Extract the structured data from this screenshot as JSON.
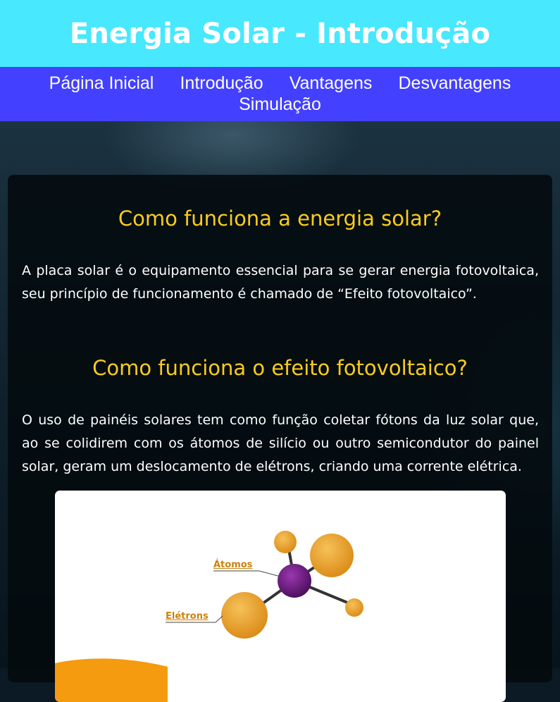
{
  "header": {
    "title": "Energia Solar - Introdução"
  },
  "nav": {
    "items": [
      {
        "label": "Página Inicial"
      },
      {
        "label": "Introdução"
      },
      {
        "label": "Vantagens"
      },
      {
        "label": "Desvantagens"
      },
      {
        "label": "Simulação"
      }
    ]
  },
  "main": {
    "section1": {
      "heading": "Como funciona a energia solar?",
      "text": "A placa solar é o equipamento essencial para se gerar energia fotovoltaica, seu princípio de funcionamento é chamado de “Efeito fotovoltaico”."
    },
    "section2": {
      "heading": "Como funciona o efeito fotovoltaico?",
      "text": "O uso de painéis solares tem como função coletar fótons da luz solar que, ao se colidirem com os átomos de silício ou outro semicondutor do painel solar, geram um deslocamento de elétrons, criando uma corrente elétrica."
    },
    "figure": {
      "label_atoms": "Átomos",
      "label_electrons": "Elétrons"
    }
  },
  "colors": {
    "header_bg": "#48e8ff",
    "nav_bg": "#4340ff",
    "heading": "#f9cc1d",
    "electron_orange": "#e6a02a",
    "atom_purple": "#6b1a80"
  }
}
